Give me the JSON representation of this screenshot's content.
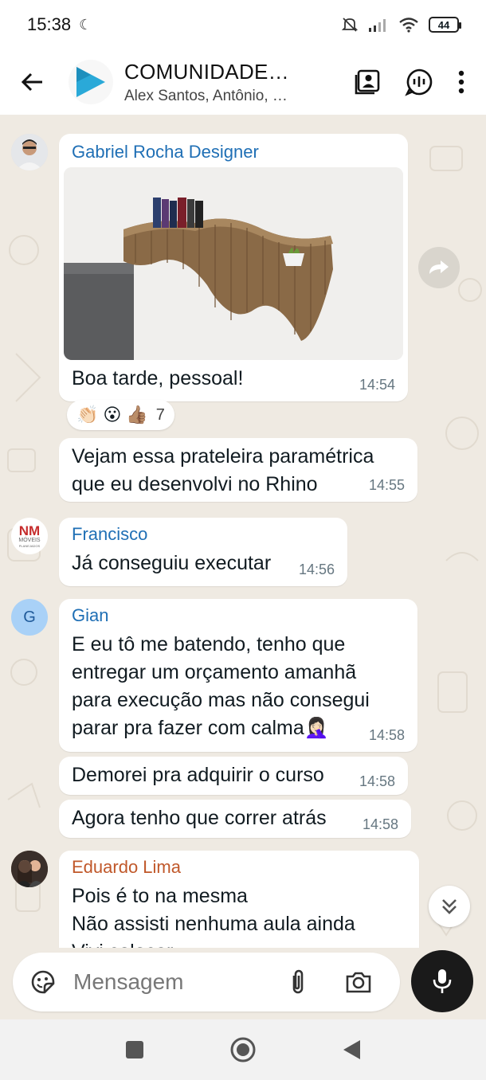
{
  "status_bar": {
    "time": "15:38",
    "battery": "44"
  },
  "header": {
    "title": "COMUNIDADE…",
    "subtitle": "Alex Santos, Antônio, …",
    "colors": {
      "logo": "#2aa9d8"
    }
  },
  "messages": [
    {
      "sender": "Gabriel Rocha Designer",
      "sender_color": "#1f6fb5",
      "has_image": true,
      "text": "Boa tarde, pessoal!",
      "time": "14:54",
      "reactions": {
        "emojis": [
          "👏🏻",
          "😮",
          "👍🏽"
        ],
        "count": "7"
      }
    },
    {
      "text_lines": [
        "Vejam essa prateleira paramétrica",
        "que eu desenvolvi no Rhino"
      ],
      "time": "14:55"
    },
    {
      "sender": "Francisco",
      "sender_color": "#1f6fb5",
      "avatar_text": "NM",
      "avatar_sub": "MÓVEIS",
      "avatar_sub2": "PLANEJADOS",
      "text": "Já conseguiu executar",
      "time": "14:56"
    },
    {
      "sender": "Gian",
      "sender_color": "#1f6fb5",
      "avatar_letter": "G",
      "text_lines": [
        "E eu tô me batendo, tenho que",
        "entregar um orçamento amanhã",
        "para execução mas não consegui",
        "parar pra fazer com calma🤦🏻‍♀️"
      ],
      "time": "14:58"
    },
    {
      "text": "Demorei pra adquirir o curso",
      "time": "14:58"
    },
    {
      "text": "Agora tenho que correr atrás",
      "time": "14:58"
    },
    {
      "sender": "Eduardo Lima",
      "sender_color": "#c0582a",
      "text_lines": [
        "Pois é to na mesma",
        "Não assisti nenhuma aula ainda",
        "Vivi colocar..."
      ]
    }
  ],
  "input": {
    "placeholder": "Mensagem"
  },
  "icons": {
    "back": "arrow-left-icon",
    "gallery": "contact-card-icon",
    "voice_chat": "voice-chat-icon",
    "menu": "more-vertical-icon",
    "forward": "forward-icon",
    "scroll": "double-chevron-down-icon",
    "sticker": "sticker-icon",
    "attach": "paperclip-icon",
    "camera": "camera-icon",
    "mic": "mic-icon"
  }
}
